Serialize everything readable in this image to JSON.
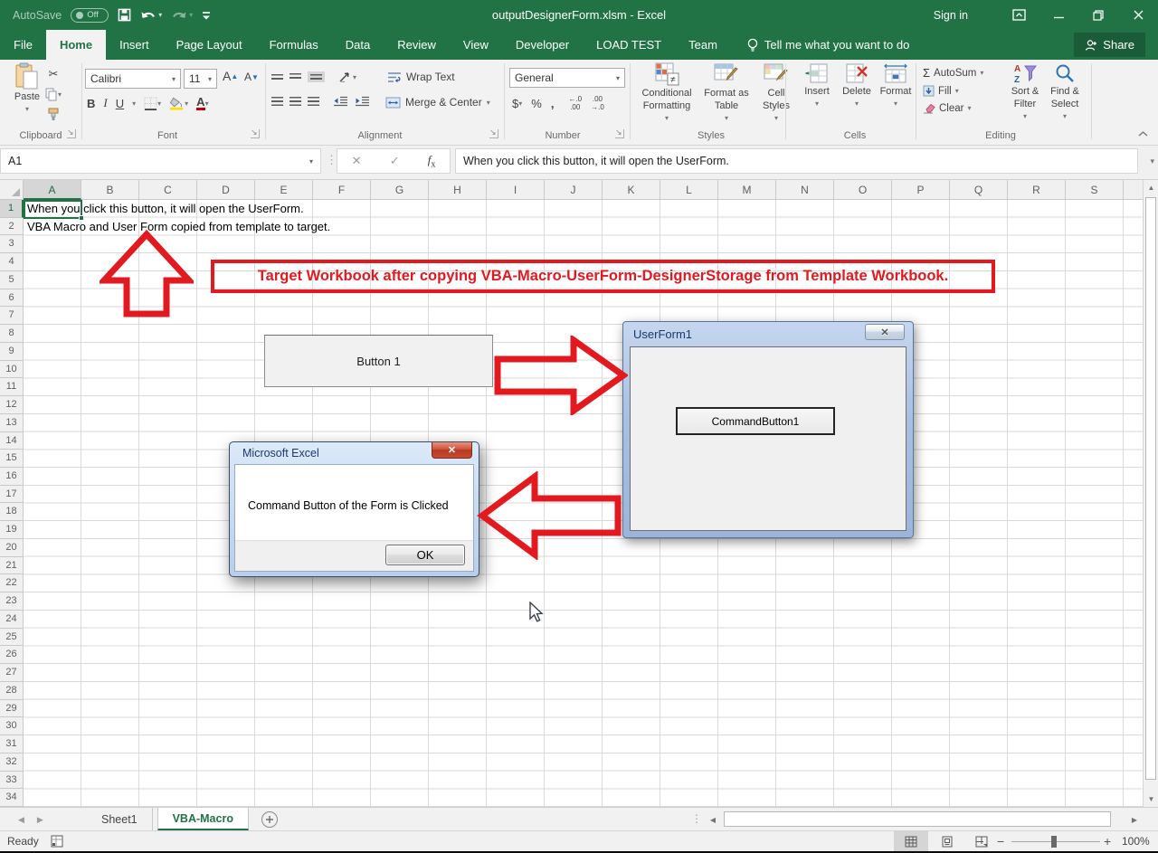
{
  "colors": {
    "excel_green": "#217346",
    "excel_green_dark": "#1A5C38",
    "annotation_red": "#E2191F",
    "fill_yellow": "#FFE000",
    "font_color_red": "#C00000"
  },
  "titlebar": {
    "autosave_label": "AutoSave",
    "autosave_state": "Off",
    "title": "outputDesignerForm.xlsm  -  Excel",
    "sign_in": "Sign in"
  },
  "ribbon": {
    "tabs": [
      {
        "label": "File",
        "active": false
      },
      {
        "label": "Home",
        "active": true
      },
      {
        "label": "Insert",
        "active": false
      },
      {
        "label": "Page Layout",
        "active": false
      },
      {
        "label": "Formulas",
        "active": false
      },
      {
        "label": "Data",
        "active": false
      },
      {
        "label": "Review",
        "active": false
      },
      {
        "label": "View",
        "active": false
      },
      {
        "label": "Developer",
        "active": false
      },
      {
        "label": "LOAD TEST",
        "active": false
      },
      {
        "label": "Team",
        "active": false
      }
    ],
    "tell_me": "Tell me what you want to do",
    "share": "Share",
    "clipboard": {
      "label": "Clipboard",
      "paste": "Paste"
    },
    "font": {
      "label": "Font",
      "name": "Calibri",
      "size": "11",
      "bold": "B",
      "italic": "I",
      "underline": "U"
    },
    "alignment": {
      "label": "Alignment",
      "wrap": "Wrap Text",
      "merge": "Merge & Center"
    },
    "number": {
      "label": "Number",
      "format": "General",
      "currency": "$",
      "percent": "%",
      "comma": ","
    },
    "styles": {
      "label": "Styles",
      "conditional": "Conditional Formatting",
      "format_table": "Format as Table",
      "cell_styles": "Cell Styles"
    },
    "cells": {
      "label": "Cells",
      "insert": "Insert",
      "delete": "Delete",
      "format": "Format"
    },
    "editing": {
      "label": "Editing",
      "autosum": "AutoSum",
      "fill": "Fill",
      "clear": "Clear",
      "sort": "Sort & Filter",
      "find": "Find & Select"
    }
  },
  "formula_bar": {
    "name_box": "A1",
    "fx": "fx",
    "formula": "When you click this button, it will open the UserForm."
  },
  "grid": {
    "columns": [
      "A",
      "B",
      "C",
      "D",
      "E",
      "F",
      "G",
      "H",
      "I",
      "J",
      "K",
      "L",
      "M",
      "N",
      "O",
      "P",
      "Q",
      "R",
      "S"
    ],
    "row_count": 34,
    "selected_column": "A",
    "selected_row": 1,
    "cell_a1": "When you click this button, it will open the UserForm.",
    "cell_a2": "VBA Macro and User Form copied from template to target."
  },
  "annotations": {
    "banner": "Target Workbook after copying VBA-Macro-UserForm-DesignerStorage from Template Workbook."
  },
  "worksheet_button": {
    "label": "Button 1"
  },
  "userform": {
    "title": "UserForm1",
    "command_button": "CommandButton1",
    "close_glyph": "✕"
  },
  "dialog": {
    "title": "Microsoft Excel",
    "message": "Command Button of the Form is Clicked",
    "ok": "OK",
    "close_glyph": "✕"
  },
  "sheet_tabs": {
    "tabs": [
      {
        "label": "Sheet1",
        "active": false
      },
      {
        "label": "VBA-Macro",
        "active": true
      }
    ]
  },
  "status_bar": {
    "mode": "Ready",
    "zoom": "100%"
  }
}
